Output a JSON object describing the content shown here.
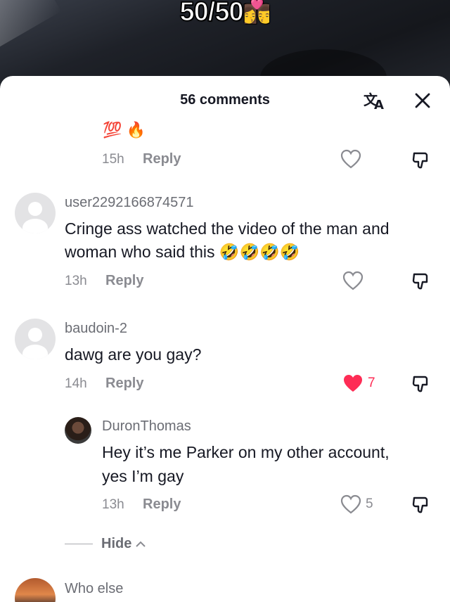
{
  "video": {
    "overlay_text": "50/50",
    "overlay_emoji": "👩‍❤️‍💋‍👨"
  },
  "sheet": {
    "comment_count": "56 comments",
    "translate_icon": "translate-icon",
    "close_icon": "close-icon"
  },
  "comments": [
    {
      "username": "",
      "text": "💯 🔥",
      "time": "15h",
      "reply": "Reply",
      "likes": "",
      "liked": false
    },
    {
      "username": "user2292166874571",
      "text_line1": "Cringe ass watched the video of the man and",
      "text_line2": "woman who said this 🤣🤣🤣🤣",
      "time": "13h",
      "reply": "Reply",
      "likes": "",
      "liked": false
    },
    {
      "username": "baudoin-2",
      "text": "dawg are you gay?",
      "time": "14h",
      "reply": "Reply",
      "likes": "7",
      "liked": true
    },
    {
      "username": "DuronThomas",
      "text_line1": "Hey it’s me Parker on my other account,",
      "text_line2": "yes I’m gay",
      "time": "13h",
      "reply": "Reply",
      "likes": "5",
      "liked": false
    },
    {
      "username": "Who else",
      "text": "",
      "time": "",
      "reply": "",
      "likes": "",
      "liked": false
    }
  ],
  "hide_replies": "Hide",
  "colors": {
    "accent_like": "#fe2c55",
    "text_primary": "#161823",
    "text_secondary": "#8a8b91"
  }
}
